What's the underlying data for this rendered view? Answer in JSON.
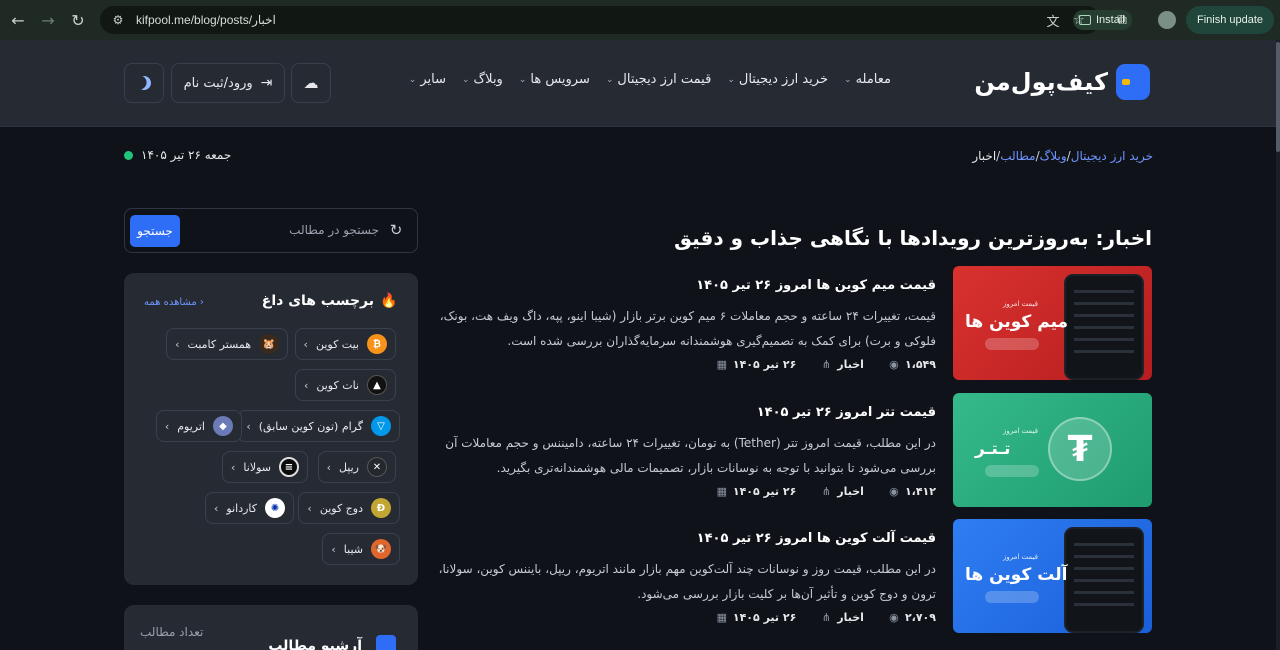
{
  "browser": {
    "url": "kifpool.me/blog/posts/اخبار",
    "install_label": "Install",
    "finish_update_label": "Finish update"
  },
  "header": {
    "logo_text": "کیف‌پول‌من",
    "nav": [
      "معامله",
      "خرید ارز دیجیتال",
      "قیمت ارز دیجیتال",
      "سرویس ها",
      "وبلاگ",
      "سایر"
    ],
    "login_label": "ورود/ثبت نام"
  },
  "breadcrumb": {
    "items": [
      "خرید ارز دیجیتال",
      "وبلاگ",
      "مطالب"
    ],
    "separator": "/",
    "current": "اخبار"
  },
  "date": "جمعه ۲۶ تیر ۱۴۰۵",
  "page_title": "اخبار: به‌روزترین رویدادها با نگاهی جذاب و دقیق",
  "posts": [
    {
      "title": "قیمت میم کوین ها امروز ۲۶ تیر ۱۴۰۵",
      "excerpt": "قیمت، تغییرات ۲۴ ساعته و حجم معاملات ۶ میم کوین برتر بازار (شیبا اینو، پپه، داگ ویف هت، بونک، فلوکی و برت) برای کمک به تصمیم‌گیری هوشمندانه سرمایه‌گذاران بررسی شده است.",
      "date": "۲۶ تیر ۱۴۰۵",
      "category": "اخبار",
      "views": "۱،۵۴۹",
      "thumb_small": "قیمت امروز",
      "thumb_big": "میم کوین ها",
      "theme": "red"
    },
    {
      "title": "قیمت تتر امروز ۲۶ تیر ۱۴۰۵",
      "excerpt": "در این مطلب، قیمت امروز تتر (Tether) به تومان، تغییرات ۲۴ ساعته، دامیننس و حجم معاملات آن بررسی می‌شود تا بتوانید با توجه به نوسانات بازار، تصمیمات مالی هوشمندانه‌تری بگیرید.",
      "date": "۲۶ تیر ۱۴۰۵",
      "category": "اخبار",
      "views": "۱،۴۱۲",
      "thumb_small": "قیمت امروز",
      "thumb_big": "تـتـر",
      "theme": "green"
    },
    {
      "title": "قیمت آلت کوین ها امروز ۲۶ تیر ۱۴۰۵",
      "excerpt": "در این مطلب، قیمت روز و نوسانات چند آلت‌کوین مهم بازار مانند اتریوم، ریپل، بایننس کوین، سولانا، ترون و دوج کوین و تأثیر آن‌ها بر کلیت بازار بررسی می‌شود.",
      "date": "۲۶ تیر ۱۴۰۵",
      "category": "اخبار",
      "views": "۲،۷۰۹",
      "thumb_small": "قیمت امروز",
      "thumb_big": "آلت کوین ها",
      "theme": "blue"
    }
  ],
  "sidebar": {
    "search_placeholder": "جستجو در مطالب",
    "search_button": "جستجو",
    "tags_title": "برچسب های داغ",
    "see_all": "مشاهده همه",
    "tags": [
      {
        "label": "بیت کوین",
        "icon": "bitcoin-icon",
        "color": "#f7931a",
        "glyph": "₿"
      },
      {
        "label": "همستر کامبت",
        "icon": "hamster-icon",
        "color": "#3a2a1e",
        "glyph": "🐹"
      },
      {
        "label": "نات کوین",
        "icon": "notcoin-icon",
        "color": "#111111",
        "glyph": "▲"
      },
      {
        "label": "گرام (تون کوین سابق)",
        "icon": "toncoin-icon",
        "color": "#0098ea",
        "glyph": "▽"
      },
      {
        "label": "اتریوم",
        "icon": "ethereum-icon",
        "color": "#6b7bb8",
        "glyph": "◆"
      },
      {
        "label": "ریپل",
        "icon": "ripple-icon",
        "color": "#23292f",
        "glyph": "✕"
      },
      {
        "label": "سولانا",
        "icon": "solana-icon",
        "color": "#0b0b0b",
        "glyph": "≡"
      },
      {
        "label": "دوج کوین",
        "icon": "dogecoin-icon",
        "color": "#c2a633",
        "glyph": "Ð"
      },
      {
        "label": "کاردانو",
        "icon": "cardano-icon",
        "color": "#ffffff",
        "glyph": "✺"
      },
      {
        "label": "شیبا",
        "icon": "shiba-icon",
        "color": "#e0672b",
        "glyph": "🐶"
      }
    ],
    "archive_count_label": "تعداد مطالب",
    "archive_title": "آرشیو مطالب"
  }
}
